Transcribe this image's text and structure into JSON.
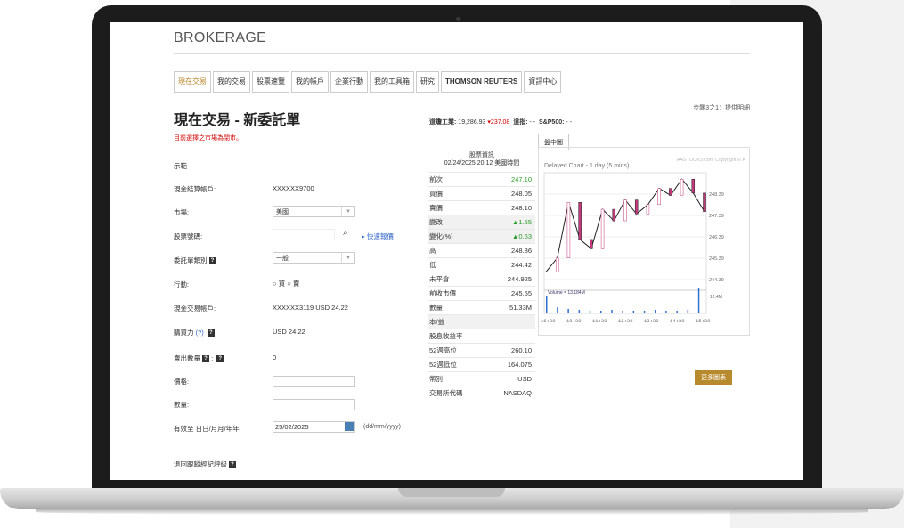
{
  "brand": "BROKERAGE",
  "tabs": [
    {
      "label": "現在交易"
    },
    {
      "label": "我的交易"
    },
    {
      "label": "股票速覽"
    },
    {
      "label": "我的帳戶"
    },
    {
      "label": "企業行動"
    },
    {
      "label": "我的工具箱"
    },
    {
      "label": "研究"
    },
    {
      "label": "THOMSON REUTERS"
    },
    {
      "label": "資訊中心"
    }
  ],
  "step": "步驟3之1：提供明細",
  "page_title": "現在交易 - 新委託單",
  "market_warning": "目前選擇之市場為閉市。",
  "ticker": {
    "dow_label": "道瓊工業:",
    "dow_value": "19,286.93",
    "dow_change": "▾237.08",
    "nasdaq_label": "道指:",
    "nasdaq_value": "- -",
    "sp_label": "S&P500:",
    "sp_value": "- -"
  },
  "form": {
    "demo": "示範",
    "settlement_account_label": "現金結算帳戶:",
    "settlement_account_value": "XXXXXX9700",
    "market_label": "市場:",
    "market_value": "美國",
    "stock_code_label": "股票號碼:",
    "quick_quote": "快速報價",
    "order_type_label": "委託單類別",
    "order_type_value": "一般",
    "action_label": "行動:",
    "buy": "買",
    "sell": "賣",
    "trading_account_label": "現金交易帳戶:",
    "trading_account_value": "XXXXXX3119 USD 24.22",
    "buying_power_label": "購買力",
    "buying_power_help": "(?)",
    "buying_power_value": "USD 24.22",
    "sell_qty_label": "賣出數量",
    "sell_qty_value": "0",
    "price_label": "價格:",
    "quantity_label": "數量:",
    "valid_until_label": "有效至 日日/月月/年年",
    "valid_until_value": "25/02/2025",
    "date_format": "(dd/mm/yyyy)",
    "bottom_label": "退回跟蹤經紀評級"
  },
  "stock_info": {
    "header": "股票資訊",
    "timestamp": "02/24/2025 20:12 美國時間",
    "rows": [
      {
        "k": "前次",
        "v": "247.10"
      },
      {
        "k": "買價",
        "v": "248.05"
      },
      {
        "k": "賣價",
        "v": "248.10"
      },
      {
        "k": "變改",
        "v": "▲1.55"
      },
      {
        "k": "變化(%)",
        "v": "▲0.63"
      },
      {
        "k": "高",
        "v": "248.86"
      },
      {
        "k": "低",
        "v": "244.42"
      },
      {
        "k": "未平倉",
        "v": "244.925"
      },
      {
        "k": "前收市價",
        "v": "245.55"
      },
      {
        "k": "數量",
        "v": "51.33M"
      },
      {
        "k": "本/益",
        "v": ""
      },
      {
        "k": "股息收益率",
        "v": ""
      },
      {
        "k": "52週高位",
        "v": "260.10"
      },
      {
        "k": "52週低位",
        "v": "164.075"
      },
      {
        "k": "幣別",
        "v": "USD"
      },
      {
        "k": "交易所代碼",
        "v": "NASDAQ"
      }
    ]
  },
  "chart": {
    "tab": "盤中圖",
    "title": "Delayed Chart - 1 day (5 mins)",
    "copyright": "AASTOCKS.com Copyright © A",
    "y_labels": [
      "248.39",
      "247.39",
      "246.39",
      "245.39",
      "244.39"
    ],
    "volume_label": "Volume = 13.184M",
    "volume_axis": "12.4M",
    "x_labels": [
      "16:00",
      "10:30",
      "11:30",
      "12:30",
      "13:30",
      "14:30",
      "15:30"
    ],
    "more_button": "更多圖表"
  },
  "chart_data": {
    "type": "line",
    "title": "Delayed Chart - 1 day (5 mins)",
    "x": [
      "16:00",
      "10:30",
      "11:30",
      "12:30",
      "13:30",
      "14:30",
      "15:30"
    ],
    "ylim": [
      244.0,
      248.8
    ],
    "series": [
      {
        "values": [
          244.6,
          245.2,
          247.6,
          246.0,
          245.6,
          247.3,
          246.8,
          247.7,
          247.1,
          247.5,
          248.2,
          247.9,
          248.6,
          248.0,
          247.2
        ]
      }
    ]
  }
}
